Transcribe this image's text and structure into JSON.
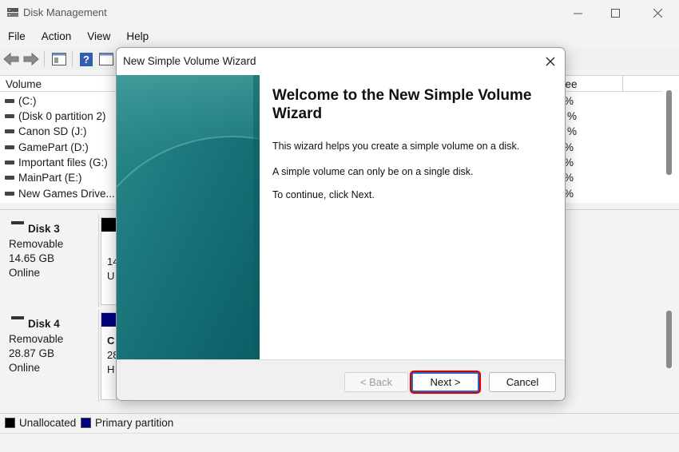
{
  "window": {
    "title": "Disk Management"
  },
  "menu": [
    "File",
    "Action",
    "View",
    "Help"
  ],
  "volume_list": {
    "header_volume": "Volume",
    "header_free": "ree",
    "rows": [
      {
        "name": "(C:)",
        "pct": "%"
      },
      {
        "name": "(Disk 0 partition 2)",
        "pct": "%"
      },
      {
        "name": "Canon SD (J:)",
        "pct": "%"
      },
      {
        "name": "GamePart (D:)",
        "pct": "%"
      },
      {
        "name": "Important files (G:)",
        "pct": "%"
      },
      {
        "name": "MainPart (E:)",
        "pct": "%"
      },
      {
        "name": "New Games Drive...",
        "pct": "%"
      }
    ]
  },
  "disks": [
    {
      "name": "Disk 3",
      "type": "Removable",
      "size": "14.65 GB",
      "status": "Online",
      "part_line1": "14",
      "part_line2": "U"
    },
    {
      "name": "Disk 4",
      "type": "Removable",
      "size": "28.87 GB",
      "status": "Online",
      "part_line1": "C",
      "part_line2": "28",
      "part_line3": "H"
    }
  ],
  "legend": {
    "unallocated": "Unallocated",
    "primary": "Primary partition"
  },
  "colors": {
    "unallocated": "#000000",
    "primary": "#00007f",
    "accent": "#2a66c8",
    "highlight": "#d00000",
    "banner": "#17757b"
  },
  "wizard": {
    "title": "New Simple Volume Wizard",
    "heading": "Welcome to the New Simple Volume Wizard",
    "para1": "This wizard helps you create a simple volume on a disk.",
    "para2": "A simple volume can only be on a single disk.",
    "para3": "To continue, click Next.",
    "back_label": "< Back",
    "next_label": "Next >",
    "cancel_label": "Cancel"
  },
  "icons": [
    "disk-management-app-icon",
    "back-arrow-icon",
    "forward-arrow-icon",
    "properties-icon",
    "help-icon",
    "console-icon",
    "drive-icon",
    "close-icon"
  ]
}
